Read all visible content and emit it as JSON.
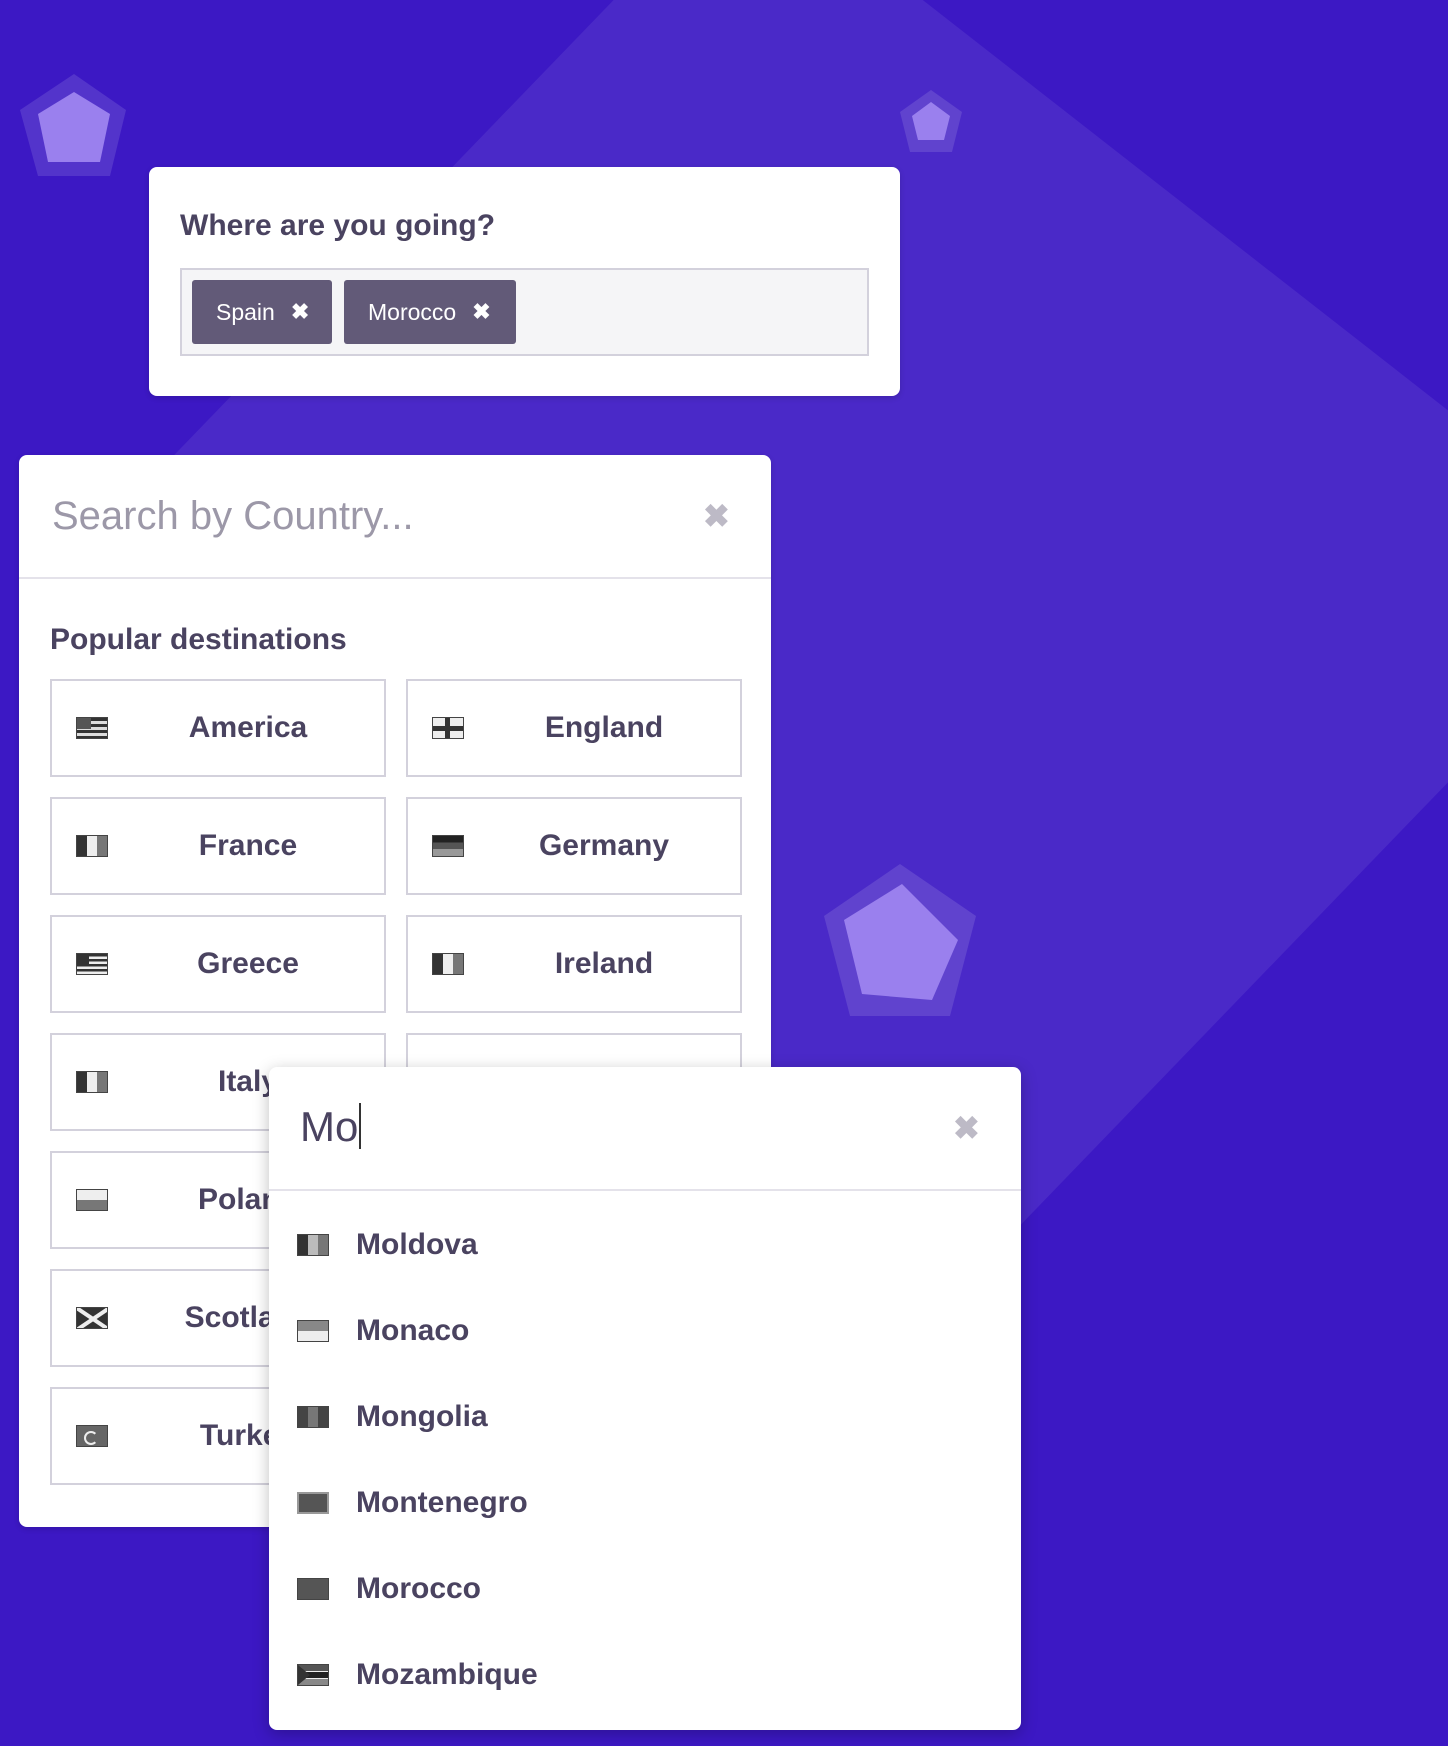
{
  "tag_input": {
    "question": "Where are you going?",
    "tags": [
      {
        "label": "Spain",
        "remove_icon": "✖"
      },
      {
        "label": "Morocco",
        "remove_icon": "✖"
      }
    ]
  },
  "popular_panel": {
    "search_placeholder": "Search by Country...",
    "clear_icon": "✖",
    "section_title": "Popular destinations",
    "destinations": [
      {
        "label": "America",
        "icon": "flag-usa-icon"
      },
      {
        "label": "England",
        "icon": "flag-england-icon"
      },
      {
        "label": "France",
        "icon": "flag-france-icon"
      },
      {
        "label": "Germany",
        "icon": "flag-germany-icon"
      },
      {
        "label": "Greece",
        "icon": "flag-greece-icon"
      },
      {
        "label": "Ireland",
        "icon": "flag-ireland-icon"
      },
      {
        "label": "Italy",
        "icon": "flag-italy-icon"
      },
      {
        "label": "",
        "icon": ""
      },
      {
        "label": "Poland",
        "icon": "flag-poland-icon"
      },
      {
        "label": "",
        "icon": ""
      },
      {
        "label": "Scotland",
        "icon": "flag-scotland-icon"
      },
      {
        "label": "",
        "icon": ""
      },
      {
        "label": "Turkey",
        "icon": "flag-turkey-icon"
      },
      {
        "label": "",
        "icon": ""
      }
    ]
  },
  "results_panel": {
    "query": "Mo",
    "clear_icon": "✖",
    "results": [
      {
        "label": "Moldova",
        "icon": "flag-moldova-icon"
      },
      {
        "label": "Monaco",
        "icon": "flag-monaco-icon"
      },
      {
        "label": "Mongolia",
        "icon": "flag-mongolia-icon"
      },
      {
        "label": "Montenegro",
        "icon": "flag-montenegro-icon"
      },
      {
        "label": "Morocco",
        "icon": "flag-morocco-icon"
      },
      {
        "label": "Mozambique",
        "icon": "flag-mozambique-icon"
      }
    ]
  },
  "colors": {
    "background": "#3c18c4",
    "tag": "#625a78",
    "text": "#4a4360",
    "accent_shape": "#9a80ee"
  }
}
